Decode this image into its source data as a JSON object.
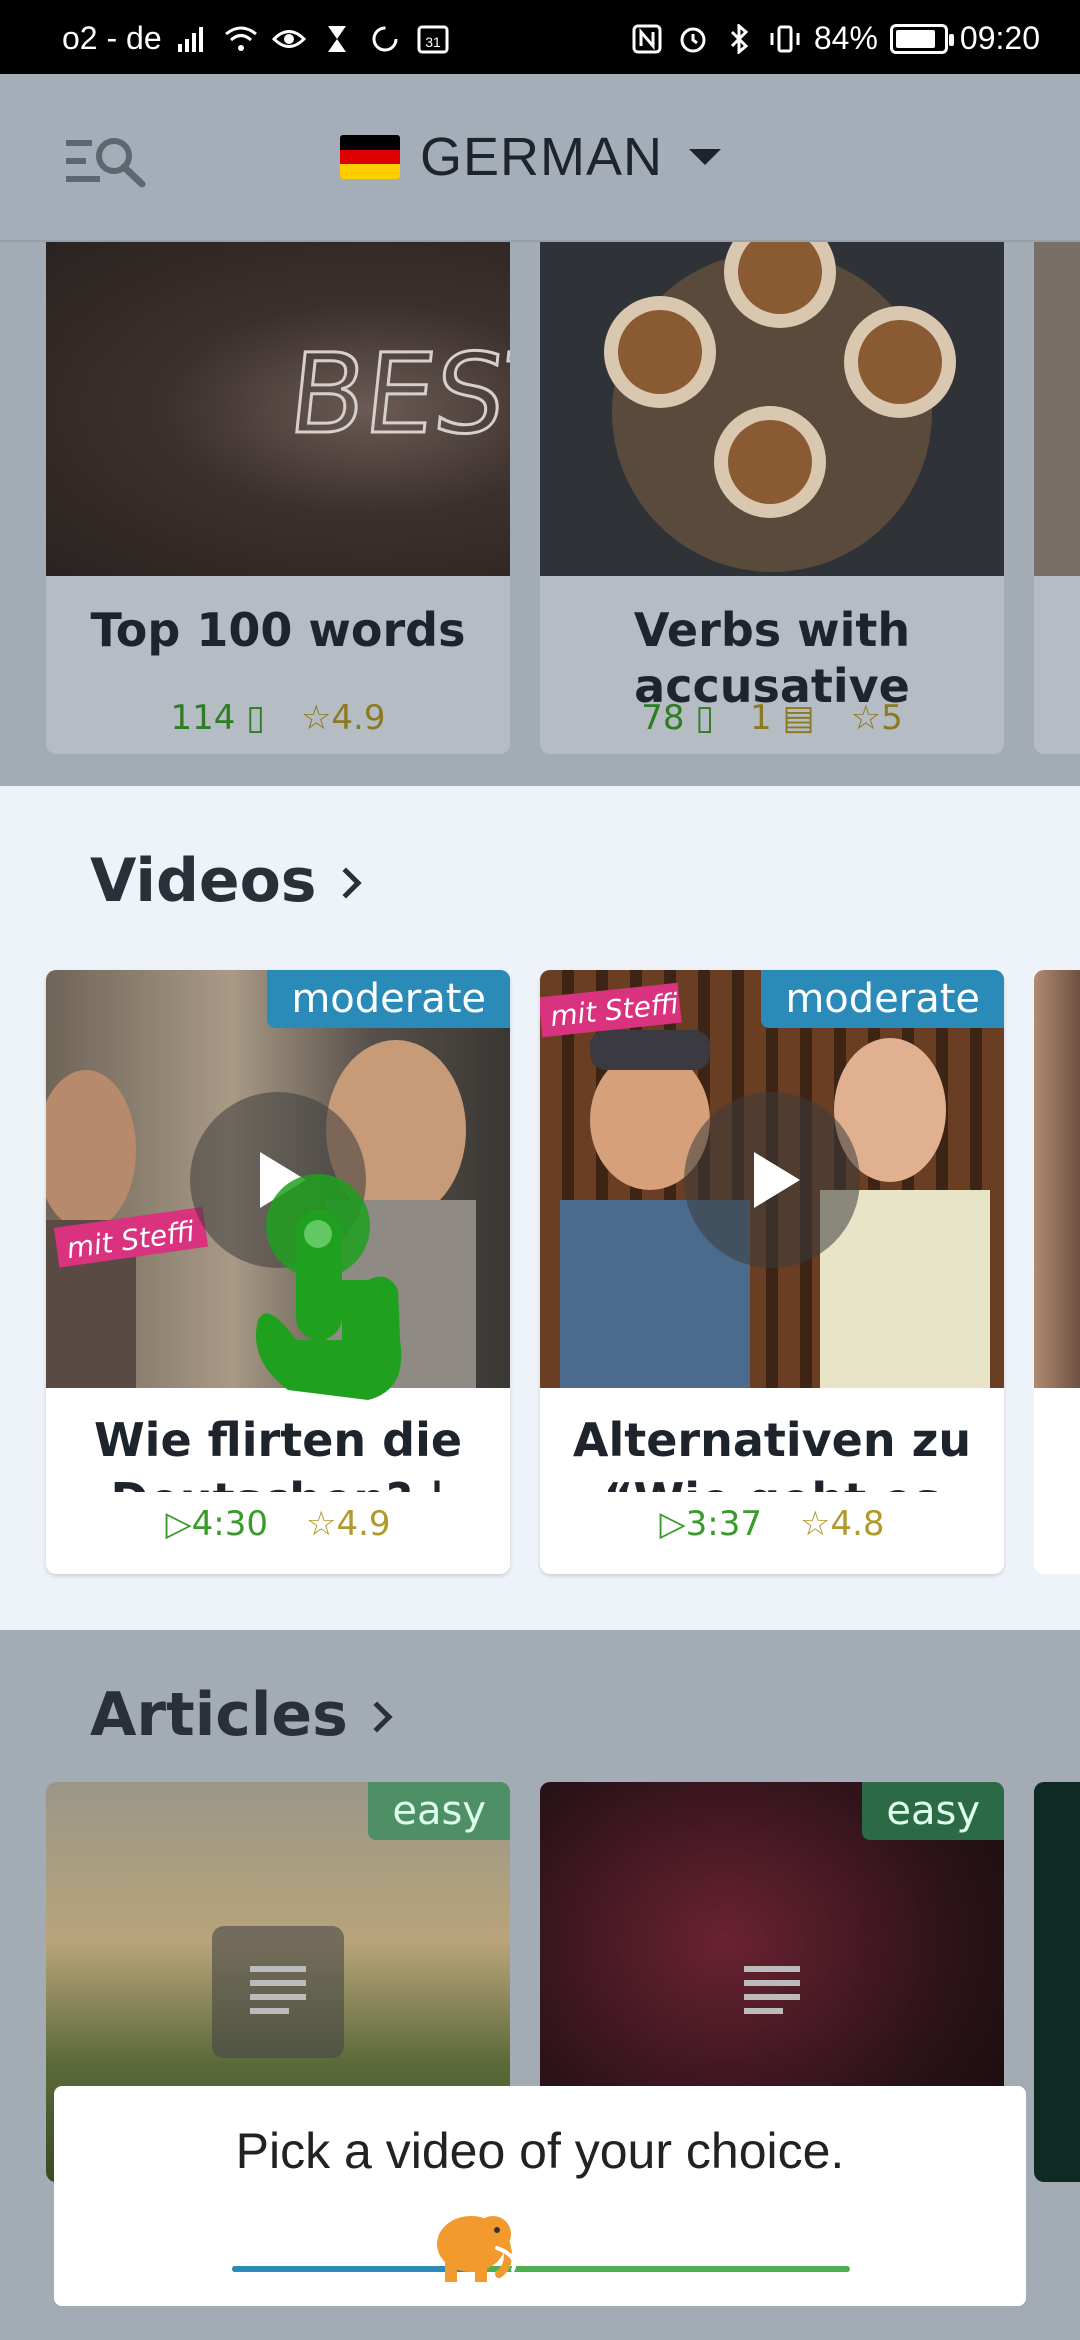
{
  "status_bar": {
    "carrier": "o2 - de",
    "calendar_day": "31",
    "battery": "84%",
    "battery_level": 0.84,
    "time": "09:20"
  },
  "header": {
    "menu_icon": "search-menu-icon",
    "language": "GERMAN",
    "flag_colors": [
      "#000000",
      "#DD0000",
      "#FFCE00"
    ]
  },
  "courses": [
    {
      "title": "Top 100 words",
      "words": "114",
      "rating": "4.9"
    },
    {
      "title": "Verbs with accusative",
      "words": "78",
      "tests": "1",
      "rating": "5"
    }
  ],
  "videos_section": {
    "heading": "Videos",
    "items": [
      {
        "title": "Wie flirten die Deutschen? |",
        "level": "moderate",
        "duration": "4:30",
        "rating": "4.9",
        "thumb_text": "mit Steffi"
      },
      {
        "title": "Alternativen zu “Wie geht es",
        "level": "moderate",
        "duration": "3:37",
        "rating": "4.8",
        "thumb_text": "mit Steffi"
      }
    ]
  },
  "articles_section": {
    "heading": "Articles",
    "items": [
      {
        "level": "easy"
      },
      {
        "level": "easy"
      }
    ]
  },
  "hint": {
    "text": "Pick a video of your choice.",
    "progress": 0.38
  },
  "colors": {
    "accent_blue": "#2a8ab8",
    "accent_green": "#4caf50",
    "gold": "#b09a2c"
  }
}
